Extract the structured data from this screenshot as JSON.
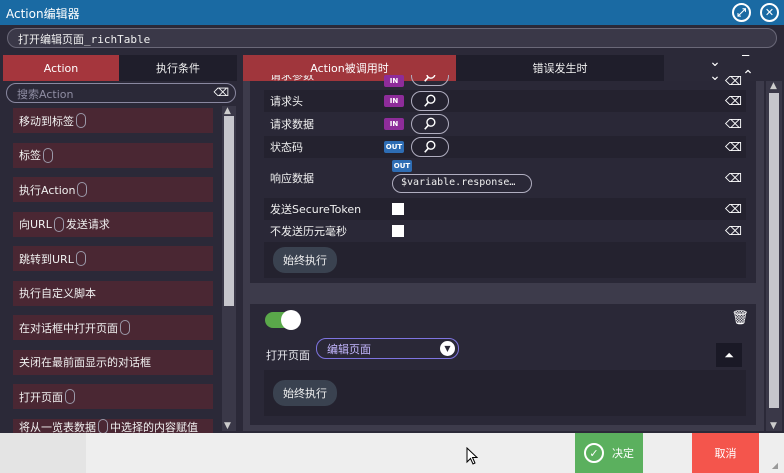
{
  "window": {
    "title": "Action编辑器",
    "restore_icon": "restore-icon",
    "close_icon": "close-icon"
  },
  "action_name": "打开编辑页面_richTable",
  "tabs": {
    "action": "Action",
    "condition": "执行条件",
    "called": "Action被调用时",
    "error": "错误发生时"
  },
  "sidebar": {
    "search_placeholder": "搜索Action",
    "items": [
      {
        "label": "移动到标签"
      },
      {
        "label": "标签"
      },
      {
        "label": "执行Action"
      },
      {
        "label_a": "向URL",
        "label_b": "发送请求"
      },
      {
        "label": "跳转到URL"
      },
      {
        "label": "执行自定义脚本"
      },
      {
        "label": "在对话框中打开页面"
      },
      {
        "label": "关闭在最前面显示的对话框"
      },
      {
        "label": "打开页面"
      },
      {
        "label_a": "将从一览表数据",
        "label_b": "中选择的内容赋值"
      }
    ]
  },
  "card1": {
    "rows": [
      {
        "label": "请求参数",
        "badge": "IN"
      },
      {
        "label": "请求头",
        "badge": "IN"
      },
      {
        "label": "请求数据",
        "badge": "IN"
      },
      {
        "label": "状态码",
        "badge": "OUT"
      },
      {
        "label": "响应数据",
        "badge": "OUT",
        "value": "$variable.response…"
      },
      {
        "label": "发送SecureToken"
      },
      {
        "label": "不发送历元毫秒"
      }
    ],
    "exec_label": "始终执行"
  },
  "card2": {
    "toggle_on": true,
    "open_page_label": "打开页面",
    "selected_page": "编辑页面",
    "exec_label": "始终执行"
  },
  "footer": {
    "ok_label": "决定",
    "cancel_label": "取消"
  },
  "colors": {
    "titlebar": "#1a6aa3",
    "tab_active": "#a5363d",
    "ok": "#5bb05e",
    "cancel": "#f4554c",
    "badge_in": "#8e2c9a",
    "badge_out": "#2e6db4"
  }
}
